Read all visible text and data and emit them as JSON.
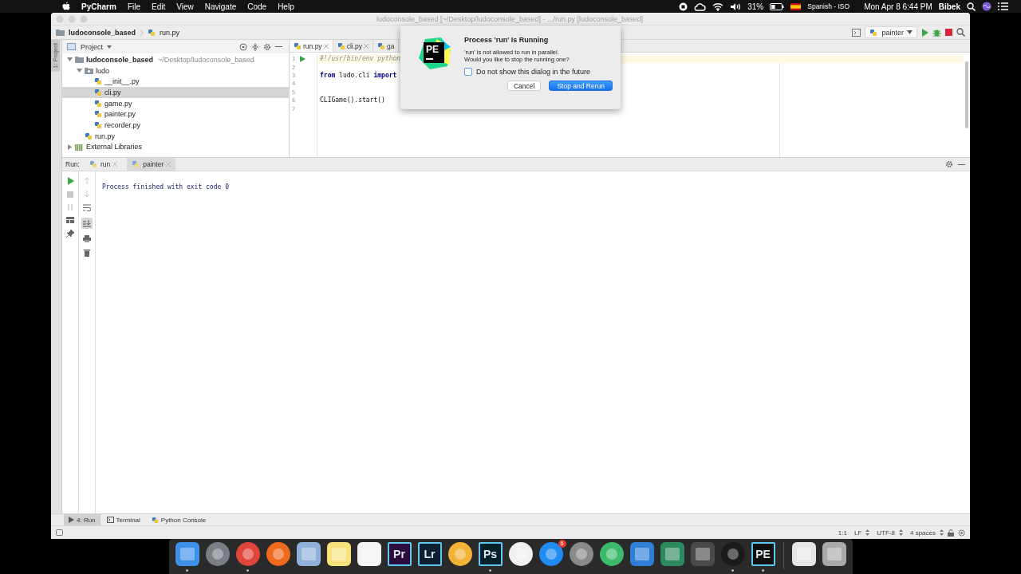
{
  "menu_bar": {
    "app": "PyCharm",
    "menus": [
      "File",
      "Edit",
      "View",
      "Navigate",
      "Code",
      "Help"
    ],
    "battery": "31%",
    "input_source": "Spanish - ISO",
    "clock": "Mon Apr 8  6:44 PM",
    "user": "Bibek"
  },
  "window": {
    "title": "ludoconsole_based [~/Desktop/ludoconsole_based] - .../run.py [ludoconsole_based]"
  },
  "breadcrumbs": [
    "ludoconsole_based",
    "run.py"
  ],
  "run_config": "painter",
  "side_tab": "1: Project",
  "project": {
    "title": "Project",
    "tree": [
      {
        "name": "ludoconsole_based",
        "path": "~/Desktop/ludoconsole_based",
        "kind": "folder",
        "expanded": true,
        "selected": false,
        "children": [
          {
            "name": "ludo",
            "kind": "package",
            "expanded": true,
            "selected": false,
            "children": [
              {
                "name": "__init__.py",
                "kind": "file",
                "selected": false
              },
              {
                "name": "cli.py",
                "kind": "file",
                "selected": true
              },
              {
                "name": "game.py",
                "kind": "file",
                "selected": false
              },
              {
                "name": "painter.py",
                "kind": "file",
                "selected": false
              },
              {
                "name": "recorder.py",
                "kind": "file",
                "selected": false
              }
            ]
          },
          {
            "name": "run.py",
            "kind": "file",
            "selected": false
          }
        ]
      },
      {
        "name": "External Libraries",
        "kind": "library",
        "expanded": false,
        "selected": false
      }
    ]
  },
  "editor": {
    "tabs": [
      {
        "label": "run.py",
        "selected": true
      },
      {
        "label": "cli.py",
        "selected": false
      },
      {
        "label": "ga",
        "selected": false
      }
    ],
    "lines": [
      {
        "number": "1",
        "code": "#!/usr/bin/env python",
        "kind": "comment",
        "runnable": true,
        "current": true
      },
      {
        "number": "2"
      },
      {
        "number": "3",
        "code": "**from** ludo.cli **import**",
        "kind": "code"
      },
      {
        "number": "4"
      },
      {
        "number": "5"
      },
      {
        "number": "6",
        "code": "CLIGame().start()",
        "kind": "code"
      },
      {
        "number": "7"
      }
    ]
  },
  "run": {
    "label": "Run:",
    "tabs": [
      {
        "label": "run",
        "selected": false
      },
      {
        "label": "painter",
        "selected": true
      }
    ],
    "output": "Process finished with exit code 0"
  },
  "tool_tabs": [
    {
      "label": "4: Run",
      "selected": true
    },
    {
      "label": "Terminal",
      "selected": false
    },
    {
      "label": "Python Console",
      "selected": false
    }
  ],
  "status_bar": {
    "position": "1:1",
    "line_separator": "LF",
    "encoding": "UTF-8",
    "indent": "4 spaces"
  },
  "dialog": {
    "logo": "PE",
    "title": "Process 'run' Is Running",
    "message": [
      "'run' is not allowed to run in parallel.",
      "Would you like to stop the running one?"
    ],
    "checkbox": {
      "label": "Do not show this dialog in the future",
      "checked": false
    },
    "buttons": [
      {
        "label": "Cancel",
        "default": false
      },
      {
        "label": "Stop and Rerun",
        "default": true
      }
    ]
  },
  "dock": [
    {
      "kind": "tile",
      "color": "#3d8fe8",
      "running": true
    },
    {
      "kind": "round",
      "color": "#7a7f86",
      "running": false
    },
    {
      "kind": "round",
      "color": "#e0443a",
      "running": true
    },
    {
      "kind": "round",
      "color": "#f06a1d",
      "running": false
    },
    {
      "kind": "tile",
      "color": "#8fb0d8",
      "running": false
    },
    {
      "kind": "tile",
      "color": "#f7e27c",
      "running": false
    },
    {
      "kind": "tile",
      "color": "#f4f4f4",
      "running": false
    },
    {
      "kind": "logo",
      "label": "Pr",
      "color": "#2c0b3f",
      "running": false
    },
    {
      "kind": "logo",
      "label": "Lr",
      "color": "#0c1f30",
      "running": false
    },
    {
      "kind": "round",
      "color": "#f2b233",
      "running": false
    },
    {
      "kind": "logo",
      "label": "Ps",
      "color": "#06202b",
      "running": true
    },
    {
      "kind": "round",
      "color": "#f1f1f1",
      "running": false
    },
    {
      "kind": "round",
      "color": "#1f8cf2",
      "badge": "6",
      "running": false
    },
    {
      "kind": "round",
      "color": "#8a8a8a",
      "running": false
    },
    {
      "kind": "round",
      "color": "#3dbb6a",
      "running": false
    },
    {
      "kind": "tile",
      "color": "#2f7fd6",
      "running": false
    },
    {
      "kind": "tile",
      "color": "#2d8a5e",
      "running": false
    },
    {
      "kind": "tile",
      "color": "#4a4a4a",
      "running": false
    },
    {
      "kind": "round",
      "color": "#1b1b1b",
      "running": true
    },
    {
      "kind": "logo",
      "label": "PE",
      "color": "#111111",
      "running": true
    },
    {
      "kind": "separator"
    },
    {
      "kind": "tile",
      "color": "#e6e6e6",
      "running": false
    },
    {
      "kind": "tile",
      "color": "#a9a9a9",
      "running": false
    }
  ]
}
